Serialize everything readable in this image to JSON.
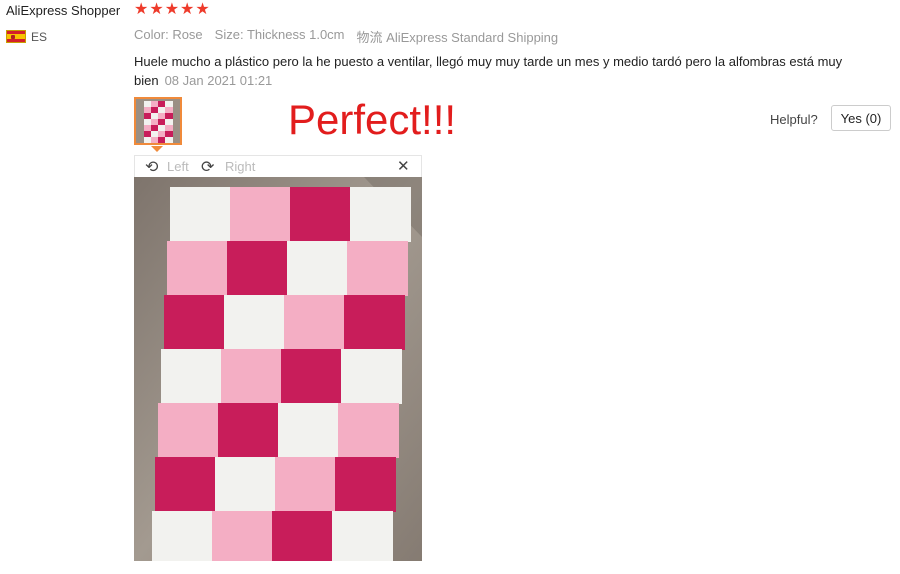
{
  "review": {
    "reviewer_name": "AliExpress Shopper",
    "rating": 5,
    "country_code": "ES",
    "color_label": "Color:",
    "color_value": "Rose",
    "size_label": "Size:",
    "size_value": "Thickness 1.0cm",
    "shipping_label": "物流",
    "shipping_value": "AliExpress Standard Shipping",
    "text": "Huele mucho a plástico pero la he puesto a ventilar, llegó muy muy tarde un mes y medio tardó pero la alfombras está muy bien",
    "date": "08 Jan 2021 01:21"
  },
  "overlay_text": "Perfect!!!",
  "helpful": {
    "label": "Helpful?",
    "button_label": "Yes (0)"
  },
  "viewer": {
    "rotate_left_label": "Left",
    "rotate_right_label": "Right",
    "icons": {
      "rotate_left": "rotate-left-icon",
      "rotate_right": "rotate-right-icon",
      "close": "close-icon"
    }
  },
  "colors": {
    "star": "#ee3b2b",
    "overlay_text": "#e21d1d",
    "thumb_border": "#f08a3a",
    "tile_rose": "#c81d5a",
    "tile_pink": "#f4aec4",
    "tile_white": "#f2f2ef"
  }
}
